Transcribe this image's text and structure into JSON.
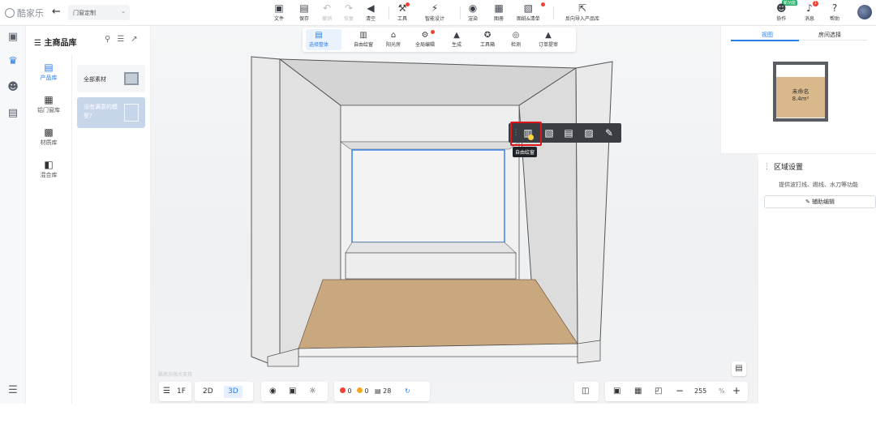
{
  "brand": "酷家乐",
  "project": {
    "name": "门窗定制"
  },
  "toolbar": {
    "items": [
      {
        "label": "文件",
        "icon": "file-icon"
      },
      {
        "label": "保存",
        "icon": "save-icon"
      },
      {
        "label": "撤销",
        "icon": "undo-icon"
      },
      {
        "label": "恢复",
        "icon": "redo-icon"
      },
      {
        "label": "清空",
        "icon": "eraser-icon"
      },
      {
        "label": "工具",
        "icon": "wrench-icon"
      },
      {
        "label": "智能设计",
        "icon": "lightning-icon"
      },
      {
        "label": "渲染",
        "icon": "camera-icon"
      },
      {
        "label": "图册",
        "icon": "album-icon"
      },
      {
        "label": "图纸&清单",
        "icon": "drawing-list-icon"
      },
      {
        "label": "反向导入产品库",
        "icon": "import-icon"
      }
    ],
    "right": [
      {
        "label": "协作",
        "icon": "collab-icon"
      },
      {
        "label": "消息",
        "icon": "bell-icon"
      },
      {
        "label": "帮助",
        "icon": "help-icon"
      }
    ],
    "new_badge": "新功能",
    "msg_count": "1"
  },
  "panel": {
    "title": "主商品库",
    "categories": [
      {
        "label": "产品库",
        "icon": "product-library-icon"
      },
      {
        "label": "铝门窗库",
        "icon": "window-library-icon"
      },
      {
        "label": "材质库",
        "icon": "material-icon"
      },
      {
        "label": "混合库",
        "icon": "mixed-library-icon"
      }
    ],
    "cards": [
      {
        "label": "全部素材"
      },
      {
        "label": "没有满意的模型?"
      }
    ]
  },
  "view_toolbar": {
    "items": [
      {
        "label": "选择整体",
        "icon": "select-all-icon",
        "active": true
      },
      {
        "label": "自由绘窗",
        "icon": "free-window-icon"
      },
      {
        "label": "阳光房",
        "icon": "sunroom-icon"
      },
      {
        "label": "全局编辑",
        "icon": "global-edit-icon"
      },
      {
        "label": "生成",
        "icon": "generate-icon"
      },
      {
        "label": "工具箱",
        "icon": "toolbox-icon"
      },
      {
        "label": "检测",
        "icon": "check-icon"
      },
      {
        "label": "订单提审",
        "icon": "order-icon"
      }
    ]
  },
  "float_toolbar": {
    "tooltip": "自由绘窗"
  },
  "minimap": {
    "tabs": [
      "视图",
      "房间选择"
    ],
    "room_name": "未命名",
    "room_area": "8.4m²"
  },
  "region": {
    "title": "区域设置",
    "hint": "提供波打线、踢线、水刀等功能",
    "button": "辅助编辑"
  },
  "bottom": {
    "floor": "1F",
    "dim2d": "2D",
    "dim3d": "3D",
    "errors": "0",
    "warnings": "0",
    "count": "28",
    "zoom": "255",
    "zoom_unit": "%",
    "watermark": "酷家乐强大支持"
  },
  "colors": {
    "accent": "#2b7de9",
    "highlight": "#e0151c",
    "floor": "#c9a77f",
    "wall": "#eeeeee"
  }
}
